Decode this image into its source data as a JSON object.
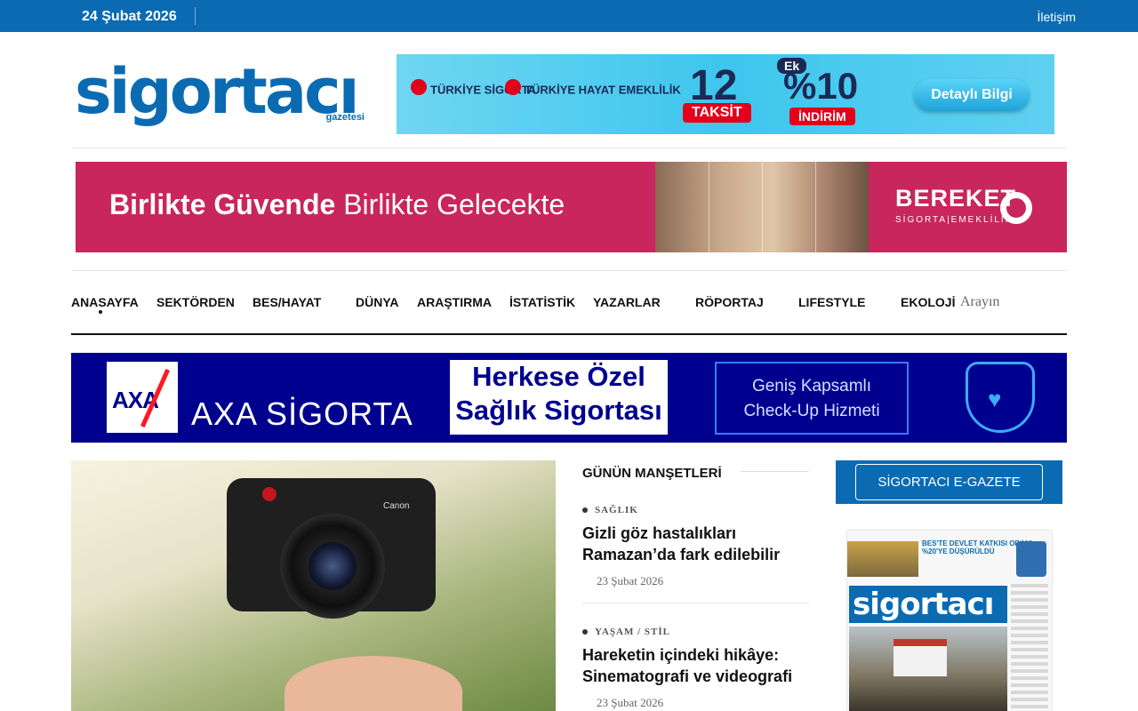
{
  "topbar": {
    "date": "24 Şubat 2026",
    "contact": "İletişim"
  },
  "logo": {
    "word": "sigortacı",
    "sub": "gazetesi"
  },
  "ad_top": {
    "brand1": "TÜRKİYE SİGORTA",
    "brand2": "TÜRKİYE HAYAT EMEKLİLİK",
    "number": "12",
    "taksit": "TAKSİT",
    "ek": "Ek",
    "percent": "%10",
    "indirim": "İNDİRİM",
    "cta": "Detaylı Bilgi"
  },
  "ad_bereket": {
    "slogan_bold": "Birlikte Güvende",
    "slogan_rest": "Birlikte Gelecekte",
    "brand": "BEREKET",
    "brand_sub": "SİGORTA|EMEKLİLİK"
  },
  "nav": {
    "items": [
      "ANASAYFA",
      "SEKTÖRDEN",
      "BES/HAYAT",
      "DÜNYA",
      "ARAŞTIRMA",
      "İSTATİSTİK",
      "YAZARLAR",
      "RÖPORTAJ",
      "LIFESTYLE",
      "EKOLOJİ"
    ],
    "search_placeholder": "Arayın"
  },
  "ad_axa": {
    "logo": "AXA",
    "name": "AXA SİGORTA",
    "line1": "Herkese Özel",
    "line2": "Sağlık Sigortası",
    "check1": "Geniş Kapsamlı",
    "check2": "Check-Up Hizmeti"
  },
  "hero": {
    "camera_brand": "Canon"
  },
  "manset": {
    "heading": "GÜNÜN MANŞETLERİ",
    "items": [
      {
        "category": "SAĞLIK",
        "title": "Gizli göz hastalıkları Ramazan’da fark edilebilir",
        "date": "23 Şubat 2026"
      },
      {
        "category": "YAŞAM / STİL",
        "title": "Hareketin içindeki hikâye: Sinematografi ve videografi",
        "date": "23 Şubat 2026"
      }
    ]
  },
  "egazete": {
    "button": "SİGORTACI E-GAZETE",
    "paper_headline": "BES'TE DEVLET KATKISI ORANI %20'YE DÜŞÜRÜLDÜ",
    "paper_logo": "sigortacı"
  },
  "colors": {
    "brand_blue": "#0a6bb3",
    "bereket": "#c8265c",
    "axa_blue": "#00008f"
  }
}
